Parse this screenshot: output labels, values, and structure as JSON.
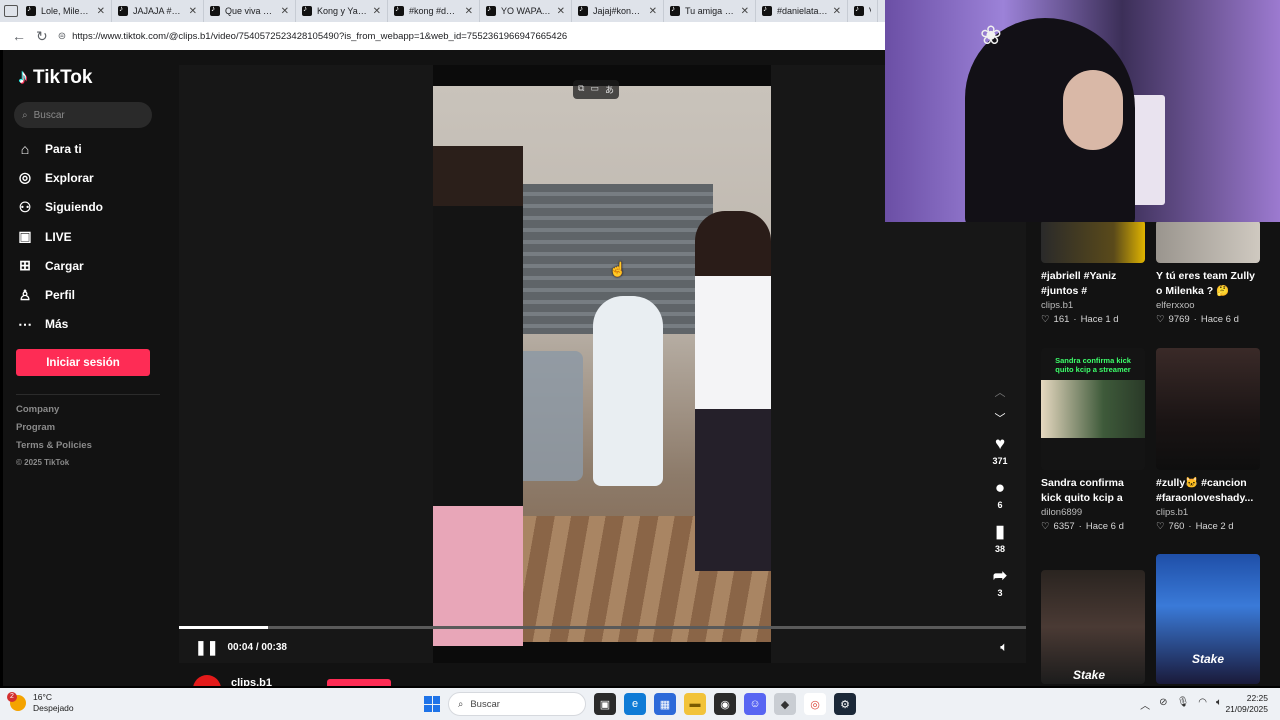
{
  "browser": {
    "tabs": [
      {
        "label": "Lole, Milenka y"
      },
      {
        "label": "JAJAJA #parati"
      },
      {
        "label": "Que viva 🙈 #"
      },
      {
        "label": "Kong y Yayito"
      },
      {
        "label": "#kong #daniel"
      },
      {
        "label": "YO WAPA // @"
      },
      {
        "label": "Jajaj#kong #fi"
      },
      {
        "label": "Tu amiga la q"
      },
      {
        "label": "#danielataqui"
      },
      {
        "label": "V"
      }
    ],
    "url": "https://www.tiktok.com/@clips.b1/video/7540572523428105490?is_from_webapp=1&web_id=7552361966947665426"
  },
  "sidebar": {
    "logo": "TikTok",
    "search_placeholder": "Buscar",
    "menu": [
      {
        "label": "Para ti",
        "icon": "home-icon"
      },
      {
        "label": "Explorar",
        "icon": "compass-icon"
      },
      {
        "label": "Siguiendo",
        "icon": "user-follow-icon"
      },
      {
        "label": "LIVE",
        "icon": "live-tv-icon"
      },
      {
        "label": "Cargar",
        "icon": "upload-icon"
      },
      {
        "label": "Perfil",
        "icon": "profile-icon"
      },
      {
        "label": "Más",
        "icon": "more-icon"
      }
    ],
    "login_label": "Iniciar sesión",
    "footer": [
      "Company",
      "Program",
      "Terms & Policies"
    ],
    "copyright": "© 2025 TikTok"
  },
  "player": {
    "time": "00:04 / 00:38",
    "progress": 0.105,
    "likes": "371",
    "comments": "6",
    "saves": "38",
    "shares": "3",
    "author": "clips.b1"
  },
  "related": [
    {
      "title": "#jabriell #Yaniz #juntos #",
      "user": "clips.b1",
      "likes": "161",
      "age": "Hace 1 d"
    },
    {
      "title": "Y tú eres team Zully o Milenka ? 🤔",
      "user": "elferxxoo",
      "likes": "9769",
      "age": "Hace 6 d"
    },
    {
      "title": "Sandra confirma kick quito kcip a stream...",
      "user": "dilon6899",
      "likes": "6357",
      "age": "Hace 6 d",
      "thumb_text": "Sandra confirma kick quito kcip a streamer"
    },
    {
      "title": "#zully🐱 #cancion #faraonloveshady...",
      "user": "clips.b1",
      "likes": "760",
      "age": "Hace 2 d"
    },
    {
      "title": "",
      "user": "",
      "likes": "",
      "age": "",
      "thumb_text": "Stake"
    },
    {
      "title": "",
      "user": "",
      "likes": "",
      "age": "",
      "thumb_text": "Stake"
    }
  ],
  "taskbar": {
    "temperature": "16°C",
    "weather": "Despejado",
    "search_placeholder": "Buscar",
    "time": "22:25",
    "date": "21/09/2025",
    "notification_count": "2"
  }
}
